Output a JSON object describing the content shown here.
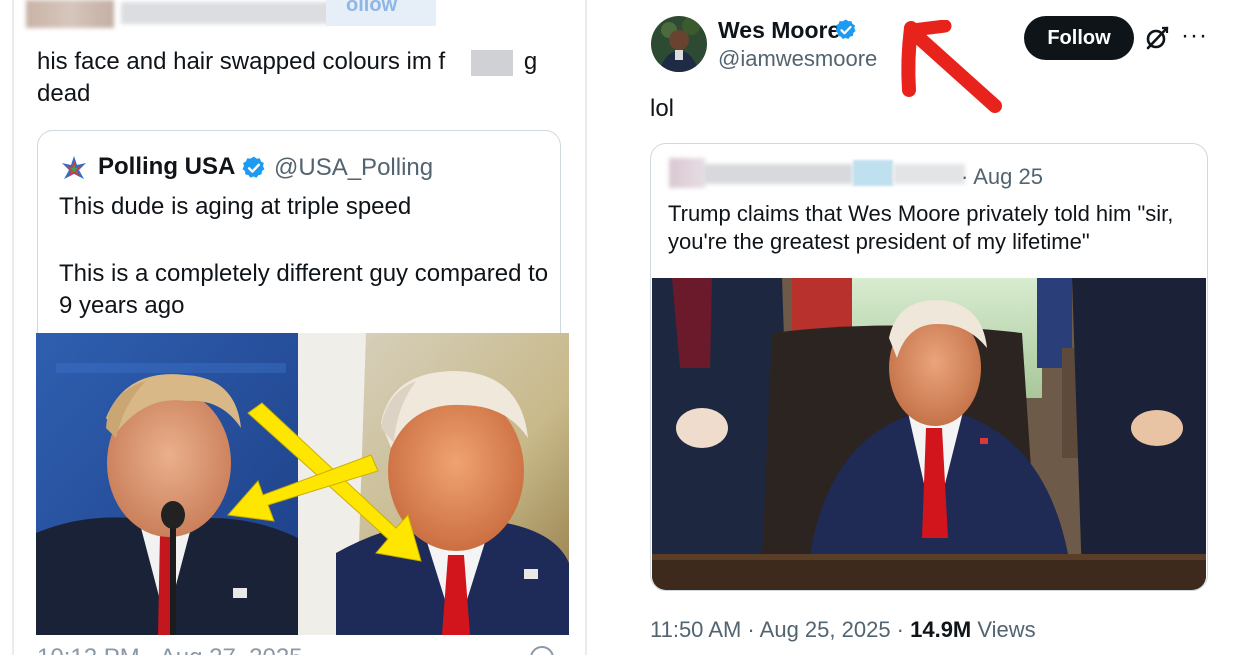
{
  "left_tweet": {
    "header_follow": "ollow",
    "text": "his face and hair swapped colours im f    g dead",
    "quote": {
      "name": "Polling USA",
      "handle": "@USA_Polling",
      "line1": "This dude is aging at triple speed",
      "line2": "This is a completely different guy compared to 9 years ago"
    },
    "footer_partial": "10:12 PM · Aug 27, 2025"
  },
  "right_tweet": {
    "name": "Wes Moore",
    "handle": "@iamwesmoore",
    "follow_label": "Follow",
    "more_label": "···",
    "text": "lol",
    "quote": {
      "date": "· Aug 25",
      "text": "Trump claims that Wes Moore privately told him \"sir, you're the greatest president of my lifetime\""
    },
    "time": "11:50 AM · Aug 25, 2025 · ",
    "views_count": "14.9M",
    "views_label": " Views"
  },
  "colors": {
    "verified": "#1d9bf0",
    "arrow_yellow": "#ffe600",
    "arrow_red": "#e8231b",
    "follow_bg": "#0f1419"
  },
  "icons": [
    "verified-badge-icon",
    "grok-icon",
    "more-icon",
    "polling-usa-logo-icon",
    "red-arrow-annotation",
    "yellow-arrow-annotation"
  ]
}
